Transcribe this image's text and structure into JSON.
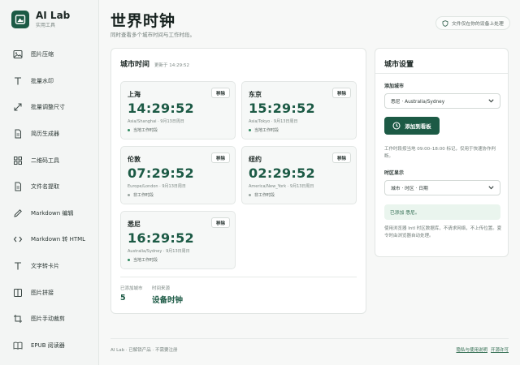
{
  "brand": {
    "title": "AI Lab",
    "subtitle": "实用工具"
  },
  "sidebar": {
    "items": [
      {
        "label": "图片压缩",
        "icon": "image-icon"
      },
      {
        "label": "批量水印",
        "icon": "text-t-icon"
      },
      {
        "label": "批量调整尺寸",
        "icon": "resize-arrows-icon"
      },
      {
        "label": "简历生成器",
        "icon": "document-icon"
      },
      {
        "label": "二维码工具",
        "icon": "grid-icon"
      },
      {
        "label": "文件名提取",
        "icon": "document-icon"
      },
      {
        "label": "Markdown 编辑",
        "icon": "pen-icon"
      },
      {
        "label": "Markdown 转 HTML",
        "icon": "code-brackets-icon"
      },
      {
        "label": "文字转卡片",
        "icon": "text-t-icon"
      },
      {
        "label": "图片拼接",
        "icon": "panels-icon"
      },
      {
        "label": "图片手动裁剪",
        "icon": "crop-icon"
      },
      {
        "label": "EPUB 阅读器",
        "icon": "book-icon"
      }
    ]
  },
  "header": {
    "title": "世界时钟",
    "subtitle": "同时查看多个城市时间与工作时段。",
    "badge": "文件仅在你的设备上处理"
  },
  "city_panel": {
    "title": "城市时间",
    "updated": "更新于 14:29:52",
    "remove_label": "移除",
    "cities": [
      {
        "name": "上海",
        "time": "14:29:52",
        "meta": "Asia/Shanghai · 9月13日周日",
        "status": "当地工作时段",
        "working": true
      },
      {
        "name": "东京",
        "time": "15:29:52",
        "meta": "Asia/Tokyo · 9月13日周日",
        "status": "当地工作时段",
        "working": true
      },
      {
        "name": "伦敦",
        "time": "07:29:52",
        "meta": "Europe/London · 9月13日周日",
        "status": "非工作时段",
        "working": false
      },
      {
        "name": "纽约",
        "time": "02:29:52",
        "meta": "America/New_York · 9月13日周日",
        "status": "非工作时段",
        "working": false
      },
      {
        "name": "悉尼",
        "time": "16:29:52",
        "meta": "Australia/Sydney · 9月13日周日",
        "status": "当地工作时段",
        "working": true
      }
    ],
    "stats": {
      "count_label": "已添加城市",
      "count_value": "5",
      "source_label": "时间来源",
      "source_value": "设备时钟"
    }
  },
  "settings": {
    "title": "城市设置",
    "add_label": "添加城市",
    "city_select_value": "悉尼 · Australia/Sydney",
    "add_button": "添加到看板",
    "work_hint": "工作时段按当地 09:00–18:00 标记，仅用于快速协作判断。",
    "display_label": "时区显示",
    "display_select_value": "城市 · 时区 · 日期",
    "success_message": "已添加 悉尼。",
    "privacy_hint": "使用浏览器 Intl 时区数据库，不请求网络，不上传位置。夏令时由浏览器自动处理。"
  },
  "footer": {
    "left": "AI Lab · 已解锁产品 · 不需要注册",
    "links": [
      "隐私与使用说明",
      "开源许可"
    ]
  },
  "colors": {
    "accent": "#1c5a45",
    "working_dot": "#2f8a5f",
    "off_dot": "#9aa5a1"
  }
}
